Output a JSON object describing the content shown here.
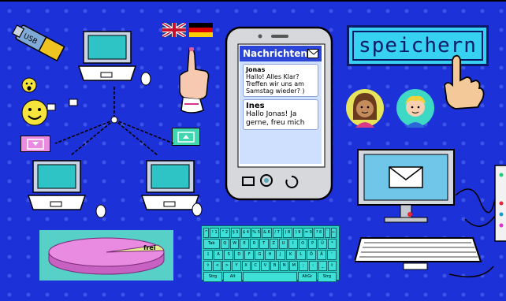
{
  "save_button": {
    "label": "speichern"
  },
  "phone": {
    "title": "Nachrichten",
    "messages": [
      {
        "sender": "Jonas",
        "text": "Hallo! Alles Klar? Treffen wir uns am Samstag wieder? )"
      },
      {
        "sender": "Ines",
        "text": "Hallo Jonas! Ja gerne, freu mich"
      }
    ]
  },
  "pie": {
    "label": "frei"
  },
  "usb": {
    "label": "USB"
  },
  "keyboard": {
    "rows": [
      [
        "^",
        "! 1",
        "\" 2",
        "§ 3",
        "$ 4",
        "% 5",
        "& 6",
        "/ 7",
        "( 8",
        ") 9",
        "= 0",
        "? ß",
        "`",
        "←"
      ],
      [
        "Tab",
        "Q",
        "W",
        "E",
        "R",
        "T",
        "Z",
        "U",
        "I",
        "O",
        "P",
        "Ü",
        "*"
      ],
      [
        "⇩",
        "A",
        "S",
        "D",
        "F",
        "G",
        "H",
        "J",
        "K",
        "L",
        "Ö",
        "Ä",
        "'"
      ],
      [
        "⇧",
        "<",
        ">",
        "Y",
        "X",
        "C",
        "V",
        "B",
        "N",
        "M",
        ";",
        ":",
        "_",
        "⇧"
      ],
      [
        "Strg",
        "Alt",
        "",
        "AltGr",
        "Strg"
      ]
    ]
  },
  "colors": {
    "background": "#1d31d9",
    "accent": "#37d1f2",
    "pie": "#e98be0"
  }
}
